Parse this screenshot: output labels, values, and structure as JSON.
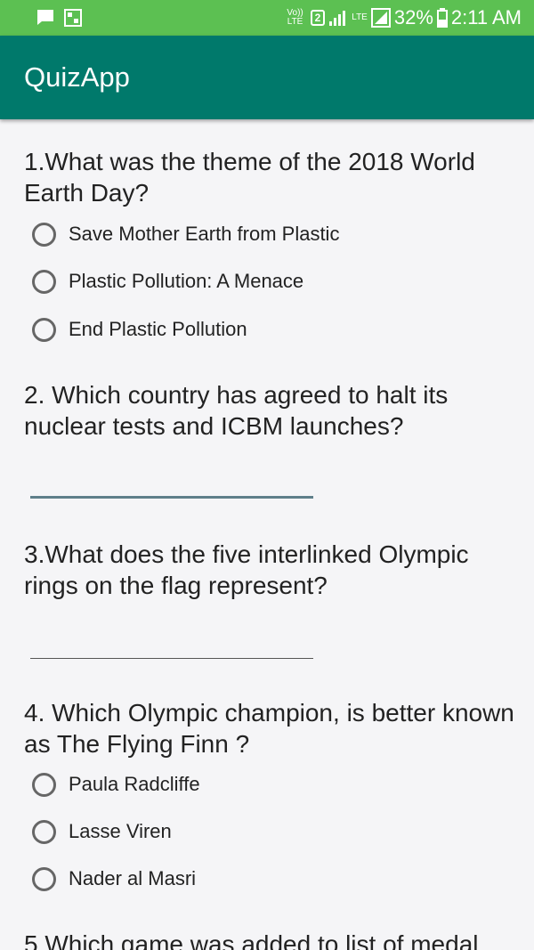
{
  "status_bar": {
    "volte": "Vo)) LTE",
    "sim": "2",
    "lte": "LTE",
    "battery": "32%",
    "time": "2:11 AM"
  },
  "app_bar": {
    "title": "QuizApp"
  },
  "questions": [
    {
      "text": "1.What was the theme of the 2018 World Earth Day?",
      "options": [
        "Save Mother Earth from Plastic",
        "Plastic Pollution: A Menace",
        "End Plastic Pollution"
      ]
    },
    {
      "text": "2. Which country has agreed to halt its nuclear tests and ICBM launches?",
      "answer_value": ""
    },
    {
      "text": "3.What does the five interlinked Olympic rings on the flag represent?",
      "answer_value": ""
    },
    {
      "text": "4. Which Olympic champion, is better known as The Flying Finn ?",
      "options": [
        "Paula Radcliffe",
        "Lasse Viren",
        "Nader al Masri"
      ]
    },
    {
      "text": "5.Which game was added to list of medal"
    }
  ],
  "colors": {
    "status_bar": "#5cc052",
    "app_bar": "#00796b",
    "background": "#f5f5f7"
  }
}
